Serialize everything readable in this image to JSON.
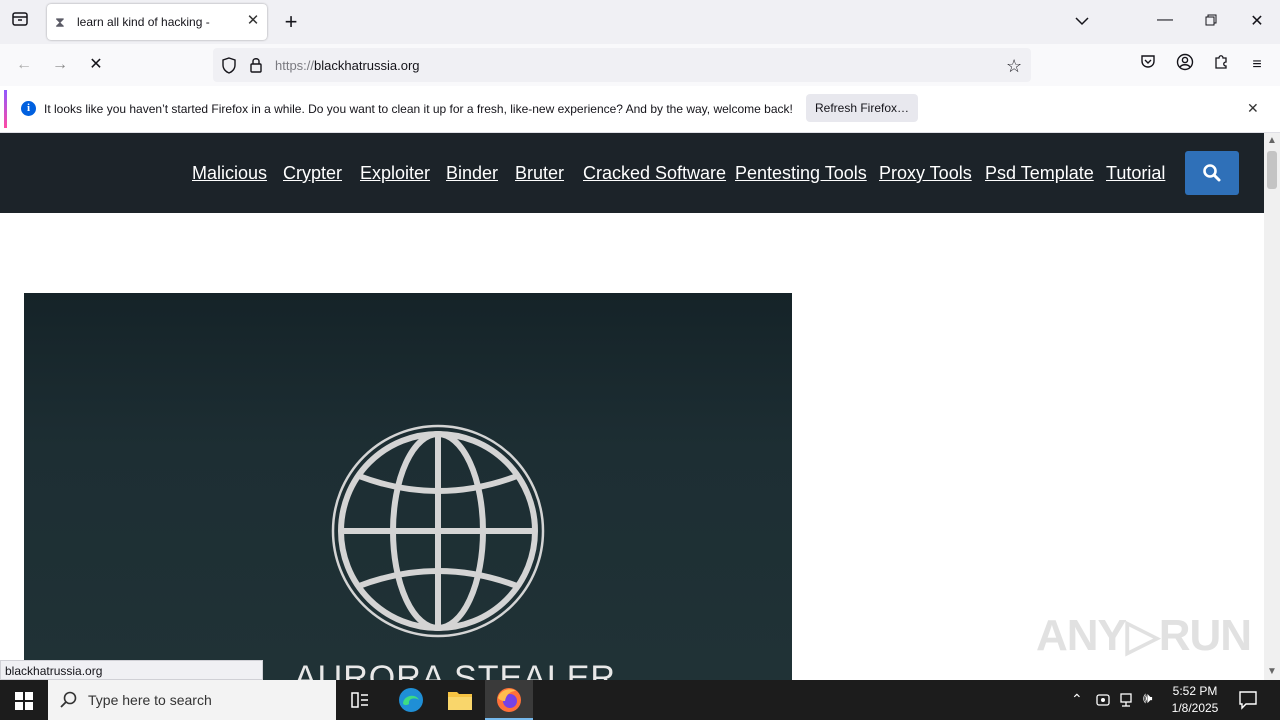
{
  "browser": {
    "tab_title": "learn all kind of hacking -",
    "url_prefix": "https://",
    "url_domain": "blackhatrussia.org"
  },
  "notification": {
    "message": "It looks like you haven’t started Firefox in a while. Do you want to clean it up for a fresh, like-new experience? And by the way, welcome back!",
    "button_label": "Refresh Firefox…"
  },
  "site": {
    "nav_links": [
      "Malicious",
      "Crypter",
      "Exploiter",
      "Binder",
      "Bruter",
      "Cracked Software",
      "Pentesting Tools",
      "Proxy Tools",
      "Psd Template",
      "Tutorial"
    ],
    "hero_title": "AURORA STEALER",
    "nav_bg": "#1c2329",
    "accent": "#2f70b8"
  },
  "status_bar": {
    "url": "blackhatrussia.org"
  },
  "watermark": "ANY RUN",
  "taskbar": {
    "search_placeholder": "Type here to search",
    "time": "5:52 PM",
    "date": "1/8/2025"
  }
}
